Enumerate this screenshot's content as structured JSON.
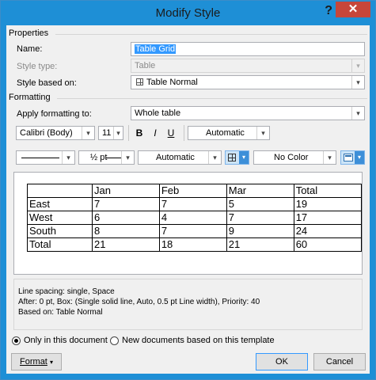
{
  "window": {
    "title": "Modify Style",
    "help": "?",
    "close": "✕"
  },
  "properties": {
    "heading": "Properties",
    "name_label": "Name:",
    "name_value": "Table Grid",
    "style_type_label": "Style type:",
    "style_type_value": "Table",
    "based_on_label": "Style based on:",
    "based_on_value": "Table Normal"
  },
  "formatting": {
    "heading": "Formatting",
    "apply_label": "Apply formatting to:",
    "apply_value": "Whole table",
    "font_value": "Calibri (Body)",
    "size_value": "11",
    "bold": "B",
    "italic": "I",
    "underline": "U",
    "font_color_value": "Automatic",
    "border_style_value": "",
    "border_width_value": "½ pt",
    "border_color_value": "Automatic",
    "shading_value": "No Color"
  },
  "preview_table": {
    "rows": [
      [
        "",
        "Jan",
        "Feb",
        "Mar",
        "Total"
      ],
      [
        "East",
        "7",
        "7",
        "5",
        "19"
      ],
      [
        "West",
        "6",
        "4",
        "7",
        "17"
      ],
      [
        "South",
        "8",
        "7",
        "9",
        "24"
      ],
      [
        "Total",
        "21",
        "18",
        "21",
        "60"
      ]
    ]
  },
  "description": {
    "line1": "Line spacing:  single, Space",
    "line2": "After:  0 pt, Box: (Single solid line, Auto,  0.5 pt Line width), Priority: 40",
    "line3": "Based on: Table Normal"
  },
  "scope": {
    "only_this_doc": "Only in this document",
    "new_docs": "New documents based on this template",
    "selected": "only_this_doc"
  },
  "buttons": {
    "format": "Format",
    "ok": "OK",
    "cancel": "Cancel"
  },
  "icons": {
    "table_normal": "table-grid-icon",
    "borders": "borders-grid-icon",
    "table_styles": "table-styles-icon"
  }
}
